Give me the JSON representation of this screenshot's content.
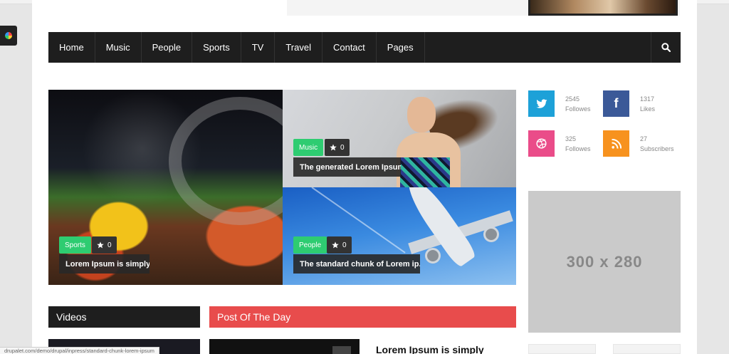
{
  "nav": {
    "items": [
      "Home",
      "Music",
      "People",
      "Sports",
      "TV",
      "Travel",
      "Contact",
      "Pages"
    ]
  },
  "featured": {
    "main": {
      "tag": "Sports",
      "rating": "0",
      "title": "Lorem Ipsum is simply"
    },
    "top_right": {
      "tag": "Music",
      "rating": "0",
      "title": "The generated Lorem Ipsum"
    },
    "bottom_right": {
      "tag": "People",
      "rating": "0",
      "title": "The standard chunk of Lorem ip..."
    }
  },
  "social": [
    {
      "network": "twitter",
      "icon": "twitter-icon",
      "count": "2545",
      "label": "Followes",
      "color": "#1da1d8"
    },
    {
      "network": "facebook",
      "icon": "facebook-icon",
      "count": "1317",
      "label": "Likes",
      "color": "#3b5998"
    },
    {
      "network": "dribbble",
      "icon": "dribbble-icon",
      "count": "325",
      "label": "Followes",
      "color": "#ea4c89"
    },
    {
      "network": "rss",
      "icon": "rss-icon",
      "count": "27",
      "label": "Subscribers",
      "color": "#f7921e"
    }
  ],
  "sidebar": {
    "ad_label": "300 x 280"
  },
  "sections": {
    "videos": "Videos",
    "post_of_the_day": "Post Of The Day",
    "post_title": "Lorem Ipsum is simply"
  },
  "status_url": "drupalet.com/demo/drupal/inpress/standard-chunk-lorem-ipsum",
  "colors": {
    "nav_bg": "#1e1e1e",
    "tag_green": "#2ecc71",
    "accent_red": "#e84c4c"
  }
}
